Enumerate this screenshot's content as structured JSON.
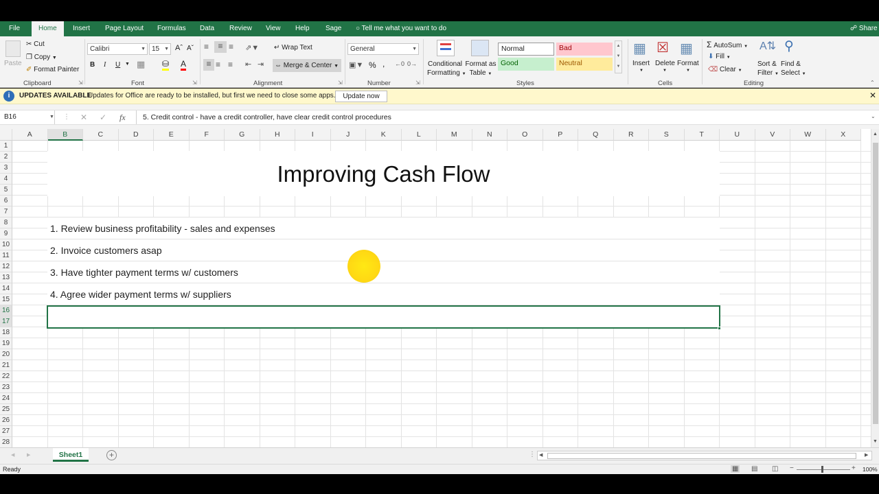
{
  "menu_tabs": [
    {
      "label": "File"
    },
    {
      "label": "Home"
    },
    {
      "label": "Insert"
    },
    {
      "label": "Page Layout"
    },
    {
      "label": "Formulas"
    },
    {
      "label": "Data"
    },
    {
      "label": "Review"
    },
    {
      "label": "View"
    },
    {
      "label": "Help"
    },
    {
      "label": "Sage"
    }
  ],
  "tell_me": "Tell me what you want to do",
  "share": "Share",
  "ribbon": {
    "clipboard": {
      "paste": "Paste",
      "cut": "Cut",
      "copy": "Copy",
      "format_painter": "Format Painter",
      "label": "Clipboard"
    },
    "font": {
      "name": "Calibri",
      "size": "15",
      "bold": "B",
      "italic": "I",
      "underline": "U",
      "label": "Font"
    },
    "alignment": {
      "wrap": "Wrap Text",
      "merge": "Merge & Center",
      "label": "Alignment"
    },
    "number": {
      "format": "General",
      "percent": "%",
      "comma": ",",
      "label": "Number"
    },
    "styles": {
      "conditional_1": "Conditional",
      "conditional_2": "Formatting",
      "format_table_1": "Format as",
      "format_table_2": "Table",
      "normal": "Normal",
      "bad": "Bad",
      "good": "Good",
      "neutral": "Neutral",
      "label": "Styles"
    },
    "cells": {
      "insert": "Insert",
      "delete": "Delete",
      "format": "Format",
      "label": "Cells"
    },
    "editing": {
      "autosum": "AutoSum",
      "fill": "Fill",
      "clear": "Clear",
      "sort_1": "Sort &",
      "sort_2": "Filter",
      "find_1": "Find &",
      "find_2": "Select",
      "label": "Editing"
    }
  },
  "info_bar": {
    "title": "UPDATES AVAILABLE",
    "message": "Updates for Office are ready to be installed, but first we need to close some apps.",
    "button": "Update now"
  },
  "formula_bar": {
    "name_box": "B16",
    "fx": "fx",
    "content": "5. Credit control - have a credit controller, have clear credit control procedures"
  },
  "columns": [
    "A",
    "B",
    "C",
    "D",
    "E",
    "F",
    "G",
    "H",
    "I",
    "J",
    "K",
    "L",
    "M",
    "N",
    "O",
    "P",
    "Q",
    "R",
    "S",
    "T",
    "U",
    "V",
    "W",
    "X"
  ],
  "rows": [
    "1",
    "2",
    "3",
    "4",
    "5",
    "6",
    "7",
    "8",
    "9",
    "10",
    "11",
    "12",
    "13",
    "14",
    "15",
    "16",
    "17",
    "18",
    "19",
    "20",
    "21",
    "22",
    "23",
    "24",
    "25",
    "26",
    "27",
    "28"
  ],
  "sheet": {
    "title": "Improving Cash Flow",
    "items": [
      "1. Review business profitability - sales and expenses",
      "2. Invoice customers asap",
      "3. Have tighter payment terms w/ customers",
      "4. Agree wider payment terms w/ suppliers"
    ]
  },
  "sheet_tab": "Sheet1",
  "status": "Ready",
  "zoom": "100%",
  "colors": {
    "excel_green": "#217346",
    "bad_bg": "#ffc7ce",
    "bad_fg": "#9c0006",
    "good_bg": "#c6efce",
    "good_fg": "#006100",
    "neutral_bg": "#ffeb9c",
    "neutral_fg": "#9c5700"
  }
}
